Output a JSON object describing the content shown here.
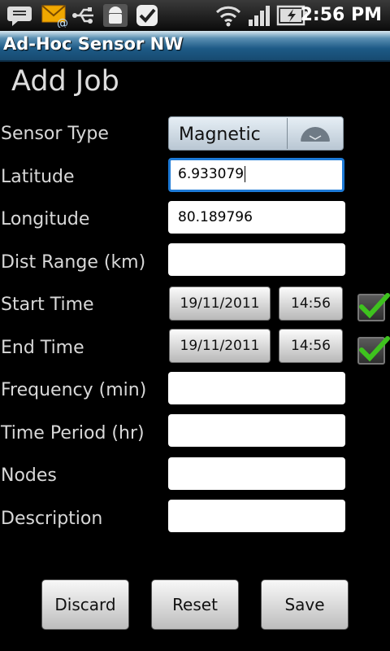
{
  "status_bar": {
    "time": "2:56 PM"
  },
  "app": {
    "title": "Ad-Hoc Sensor NW"
  },
  "page": {
    "heading": "Add Job"
  },
  "form": {
    "sensor_type": {
      "label": "Sensor Type",
      "value": "Magnetic"
    },
    "latitude": {
      "label": "Latitude",
      "value": "6.933079"
    },
    "longitude": {
      "label": "Longitude",
      "value": "80.189796"
    },
    "dist_range": {
      "label": "Dist Range (km)",
      "value": ""
    },
    "start_time": {
      "label": "Start Time",
      "date": "19/11/2011",
      "time": "14:56",
      "checked": true
    },
    "end_time": {
      "label": "End Time",
      "date": "19/11/2011",
      "time": "14:56",
      "checked": true
    },
    "frequency": {
      "label": "Frequency (min)",
      "value": ""
    },
    "time_period": {
      "label": "Time Period (hr)",
      "value": ""
    },
    "nodes": {
      "label": "Nodes",
      "value": ""
    },
    "description": {
      "label": "Description",
      "value": ""
    }
  },
  "actions": {
    "discard": "Discard",
    "reset": "Reset",
    "save": "Save"
  },
  "colors": {
    "accent_focus": "#1d7ad6",
    "check_green": "#3ec21e",
    "titlebar": "#1d5a86"
  }
}
